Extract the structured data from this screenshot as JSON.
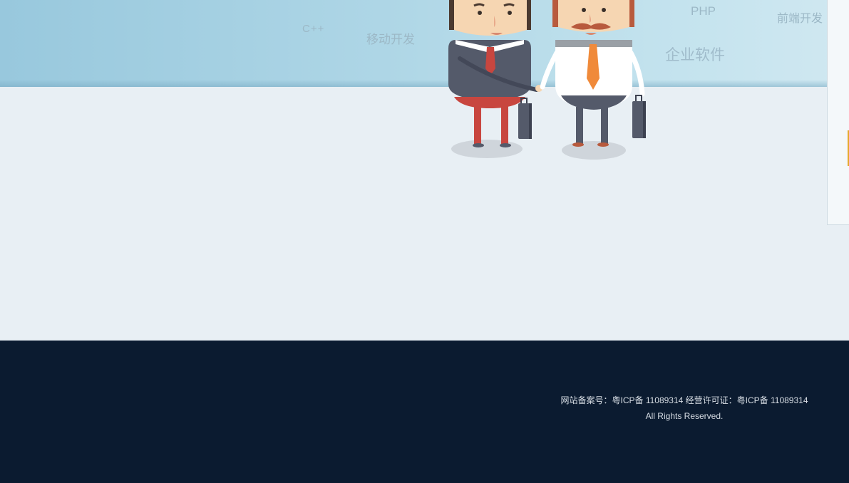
{
  "banner": {
    "tags": {
      "cpp": "C++",
      "mobile": "移动开发",
      "php": "PHP",
      "frontend": "前端开发",
      "enterprise": "企业软件"
    }
  },
  "illustration": {
    "name": "businessmen-handshake",
    "colors": {
      "suit_dark": "#545a6a",
      "tie_red": "#c8463f",
      "tie_orange": "#f08a3a",
      "skin": "#f6d6b2",
      "hair_brown": "#4b3a30",
      "hair_auburn": "#b85a3d"
    }
  },
  "footer": {
    "record_line": "网站备案号：粤ICP备 11089314 经营许可证：粤ICP备 11089314",
    "rights": "All Rights Reserved."
  },
  "colors": {
    "banner_start": "#98c8dd",
    "banner_end": "#d0e8f1",
    "content_bg": "#e8eff4",
    "footer_bg": "#0b1b30",
    "footer_text": "#d7dde4",
    "accent": "#e5a82a"
  }
}
